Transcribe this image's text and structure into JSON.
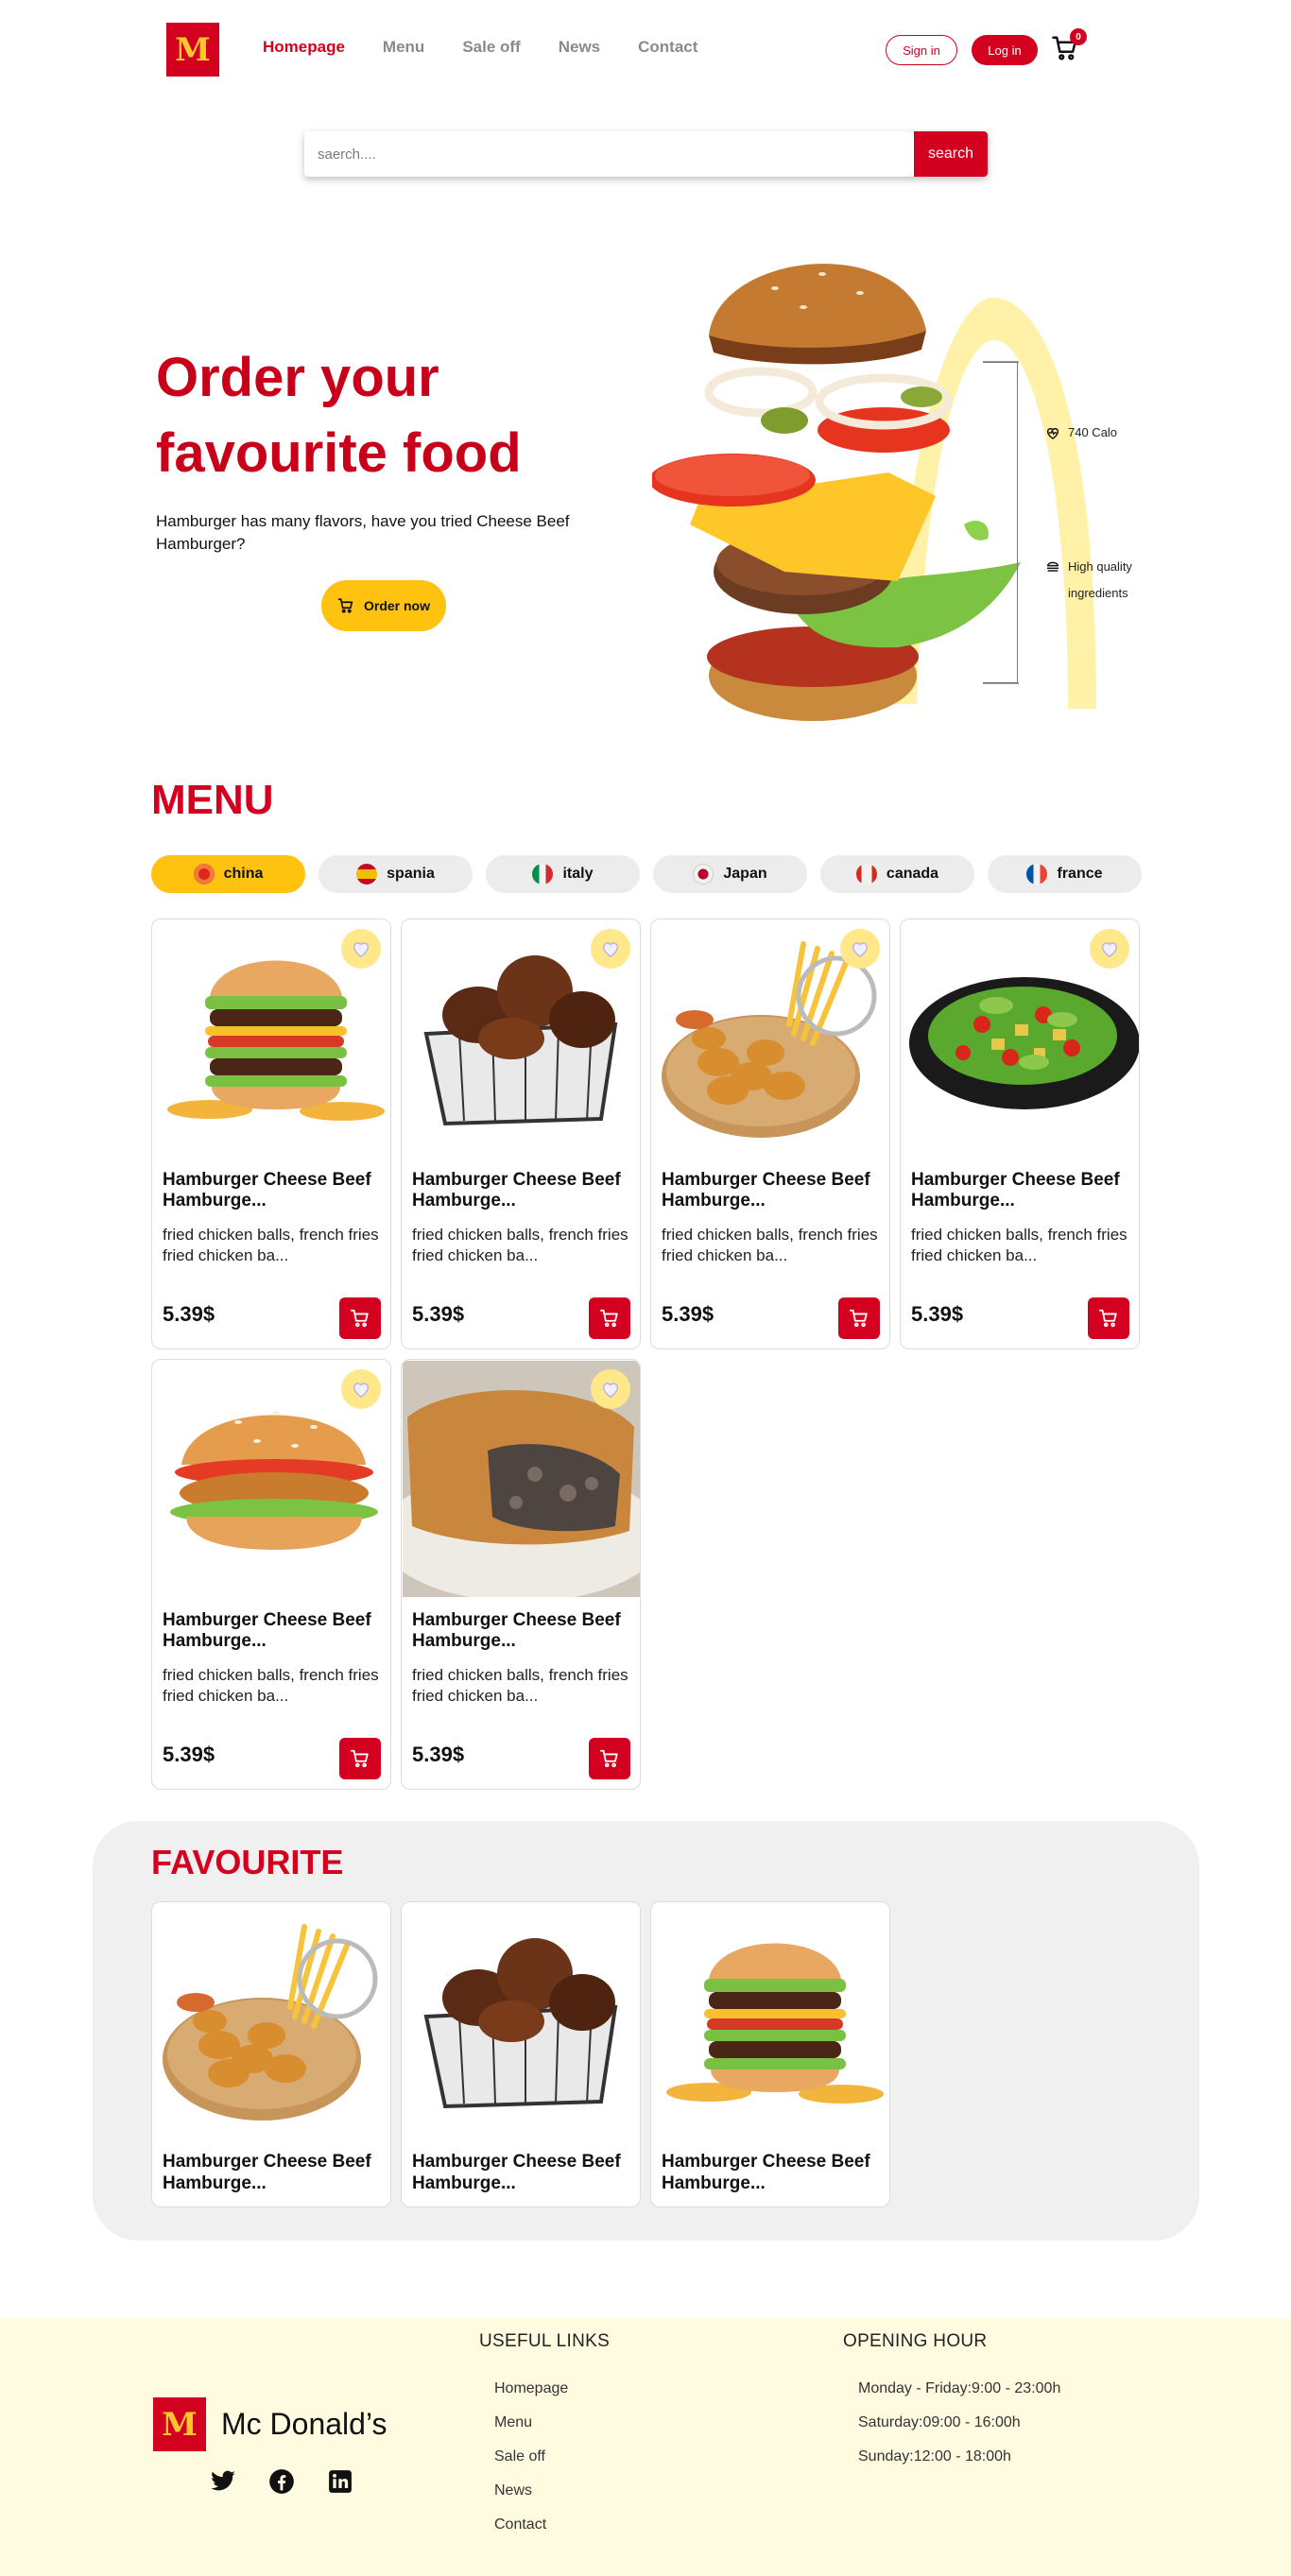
{
  "nav": {
    "logo": "M",
    "links": [
      "Homepage",
      "Menu",
      "Sale off",
      "News",
      "Contact"
    ],
    "signin": "Sign in",
    "login": "Log in",
    "cart_count": "0"
  },
  "search": {
    "placeholder": "saerch....",
    "button": "search"
  },
  "hero": {
    "title_line1": "Order your",
    "title_line2": "favourite food",
    "subtitle": "Hamburger has many flavors, have you tried Cheese Beef Hamburger?",
    "order_button": "Order now",
    "features": [
      "740 Calo",
      "High quality",
      "ingredients"
    ]
  },
  "menu": {
    "title": "MENU",
    "categories": [
      {
        "label": "china",
        "flag": "#e0261b"
      },
      {
        "label": "spania",
        "flag": "#f1bf00"
      },
      {
        "label": "italy",
        "flag": "#009246"
      },
      {
        "label": "Japan",
        "flag": "#bc002d"
      },
      {
        "label": "canada",
        "flag": "#d52b1e"
      },
      {
        "label": "france",
        "flag": "#0055a4"
      }
    ],
    "items": [
      {
        "title": "Hamburger Cheese Beef Hamburge...",
        "desc": "fried chicken balls, french fries fried chicken ba...",
        "price": "5.39$",
        "image": "burger-tall"
      },
      {
        "title": "Hamburger Cheese Beef Hamburge...",
        "desc": "fried chicken balls, french fries fried chicken ba...",
        "price": "5.39$",
        "image": "wings-basket"
      },
      {
        "title": "Hamburger Cheese Beef Hamburge...",
        "desc": "fried chicken balls, french fries fried chicken ba...",
        "price": "5.39$",
        "image": "nuggets-fries"
      },
      {
        "title": "Hamburger Cheese Beef Hamburge...",
        "desc": "fried chicken balls, french fries fried chicken ba...",
        "price": "5.39$",
        "image": "salad-bowl"
      },
      {
        "title": "Hamburger Cheese Beef Hamburge...",
        "desc": "fried chicken balls, french fries fried chicken ba...",
        "price": "5.39$",
        "image": "chicken-burger"
      },
      {
        "title": "Hamburger Cheese Beef Hamburge...",
        "desc": "fried chicken balls, french fries fried chicken ba...",
        "price": "5.39$",
        "image": "meat-pie"
      }
    ]
  },
  "favourite": {
    "title": "FAVOURITE",
    "items": [
      {
        "title": "Hamburger Cheese Beef Hamburge...",
        "image": "nuggets-fries"
      },
      {
        "title": "Hamburger Cheese Beef Hamburge...",
        "image": "wings-basket"
      },
      {
        "title": "Hamburger Cheese Beef Hamburge...",
        "image": "burger-tall"
      }
    ]
  },
  "footer": {
    "logo": "M",
    "brand": "Mc Donald’s",
    "useful_links_title": "USEFUL LINKS",
    "useful_links": [
      "Homepage",
      "Menu",
      "Sale off",
      "News",
      "Contact"
    ],
    "opening_title": "OPENING HOUR",
    "opening_hours": [
      "Monday - Friday:9:00 - 23:00h",
      "Saturday:09:00 - 16:00h",
      "Sunday:12:00 - 18:00h"
    ],
    "social": [
      "twitter-icon",
      "facebook-icon",
      "linkedin-icon"
    ]
  },
  "colors": {
    "brand_red": "#d4001f",
    "brand_yellow": "#ffc72c",
    "footer_bg": "#fffbe0"
  }
}
